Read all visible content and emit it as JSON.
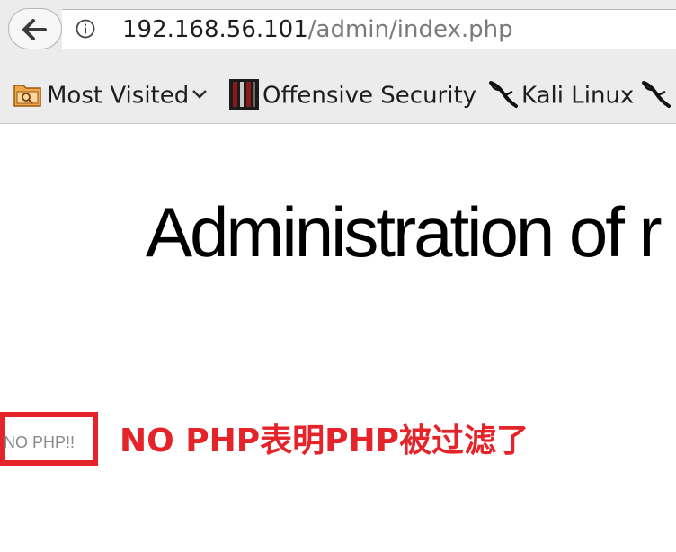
{
  "browser": {
    "url_host": "192.168.56.101",
    "url_path": "/admin/index.php"
  },
  "bookmarks": [
    {
      "label": "Most Visited",
      "icon": "folder-icon"
    },
    {
      "label": "Offensive Security",
      "icon": "offensive-security-icon"
    },
    {
      "label": "Kali Linux",
      "icon": "kali-dragon-icon"
    },
    {
      "label": "",
      "icon": "kali-dragon-icon"
    }
  ],
  "page": {
    "heading": "Administration of r",
    "message": "NO PHP!!"
  },
  "annotation": {
    "text": "NO PHP表明PHP被过滤了",
    "color": "#e5242a"
  }
}
